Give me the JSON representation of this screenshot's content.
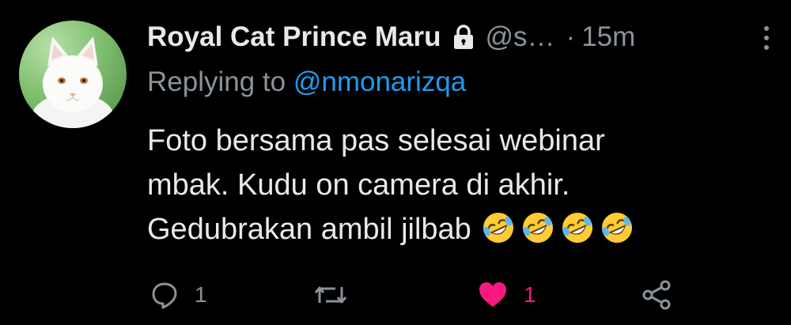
{
  "tweet": {
    "display_name": "Royal Cat Prince Maru",
    "handle": "@s…",
    "separator": "·",
    "time": "15m",
    "reply_prefix": "Replying to",
    "reply_to": "@nmonarizqa",
    "text_lines": [
      "Foto bersama pas selesai webinar",
      "mbak. Kudu on camera di akhir.",
      "Gedubrakan ambil jilbab"
    ],
    "emoji": [
      "rolling-on-floor-laughing",
      "rolling-on-floor-laughing",
      "rolling-on-floor-laughing",
      "rolling-on-floor-laughing"
    ]
  },
  "actions": {
    "reply_count": "1",
    "retweet_count": "",
    "like_count": "1"
  },
  "icons": {
    "lock": "lock-icon",
    "more": "more-vertical-icon",
    "reply": "comment-icon",
    "retweet": "retweet-icon",
    "like": "heart-icon",
    "share": "share-icon"
  },
  "colors": {
    "background": "#000000",
    "text": "#e7e9ea",
    "secondary": "#8b9299",
    "mention": "#1d9bf0",
    "like": "#f91880",
    "emoji": "#ffcc33"
  }
}
